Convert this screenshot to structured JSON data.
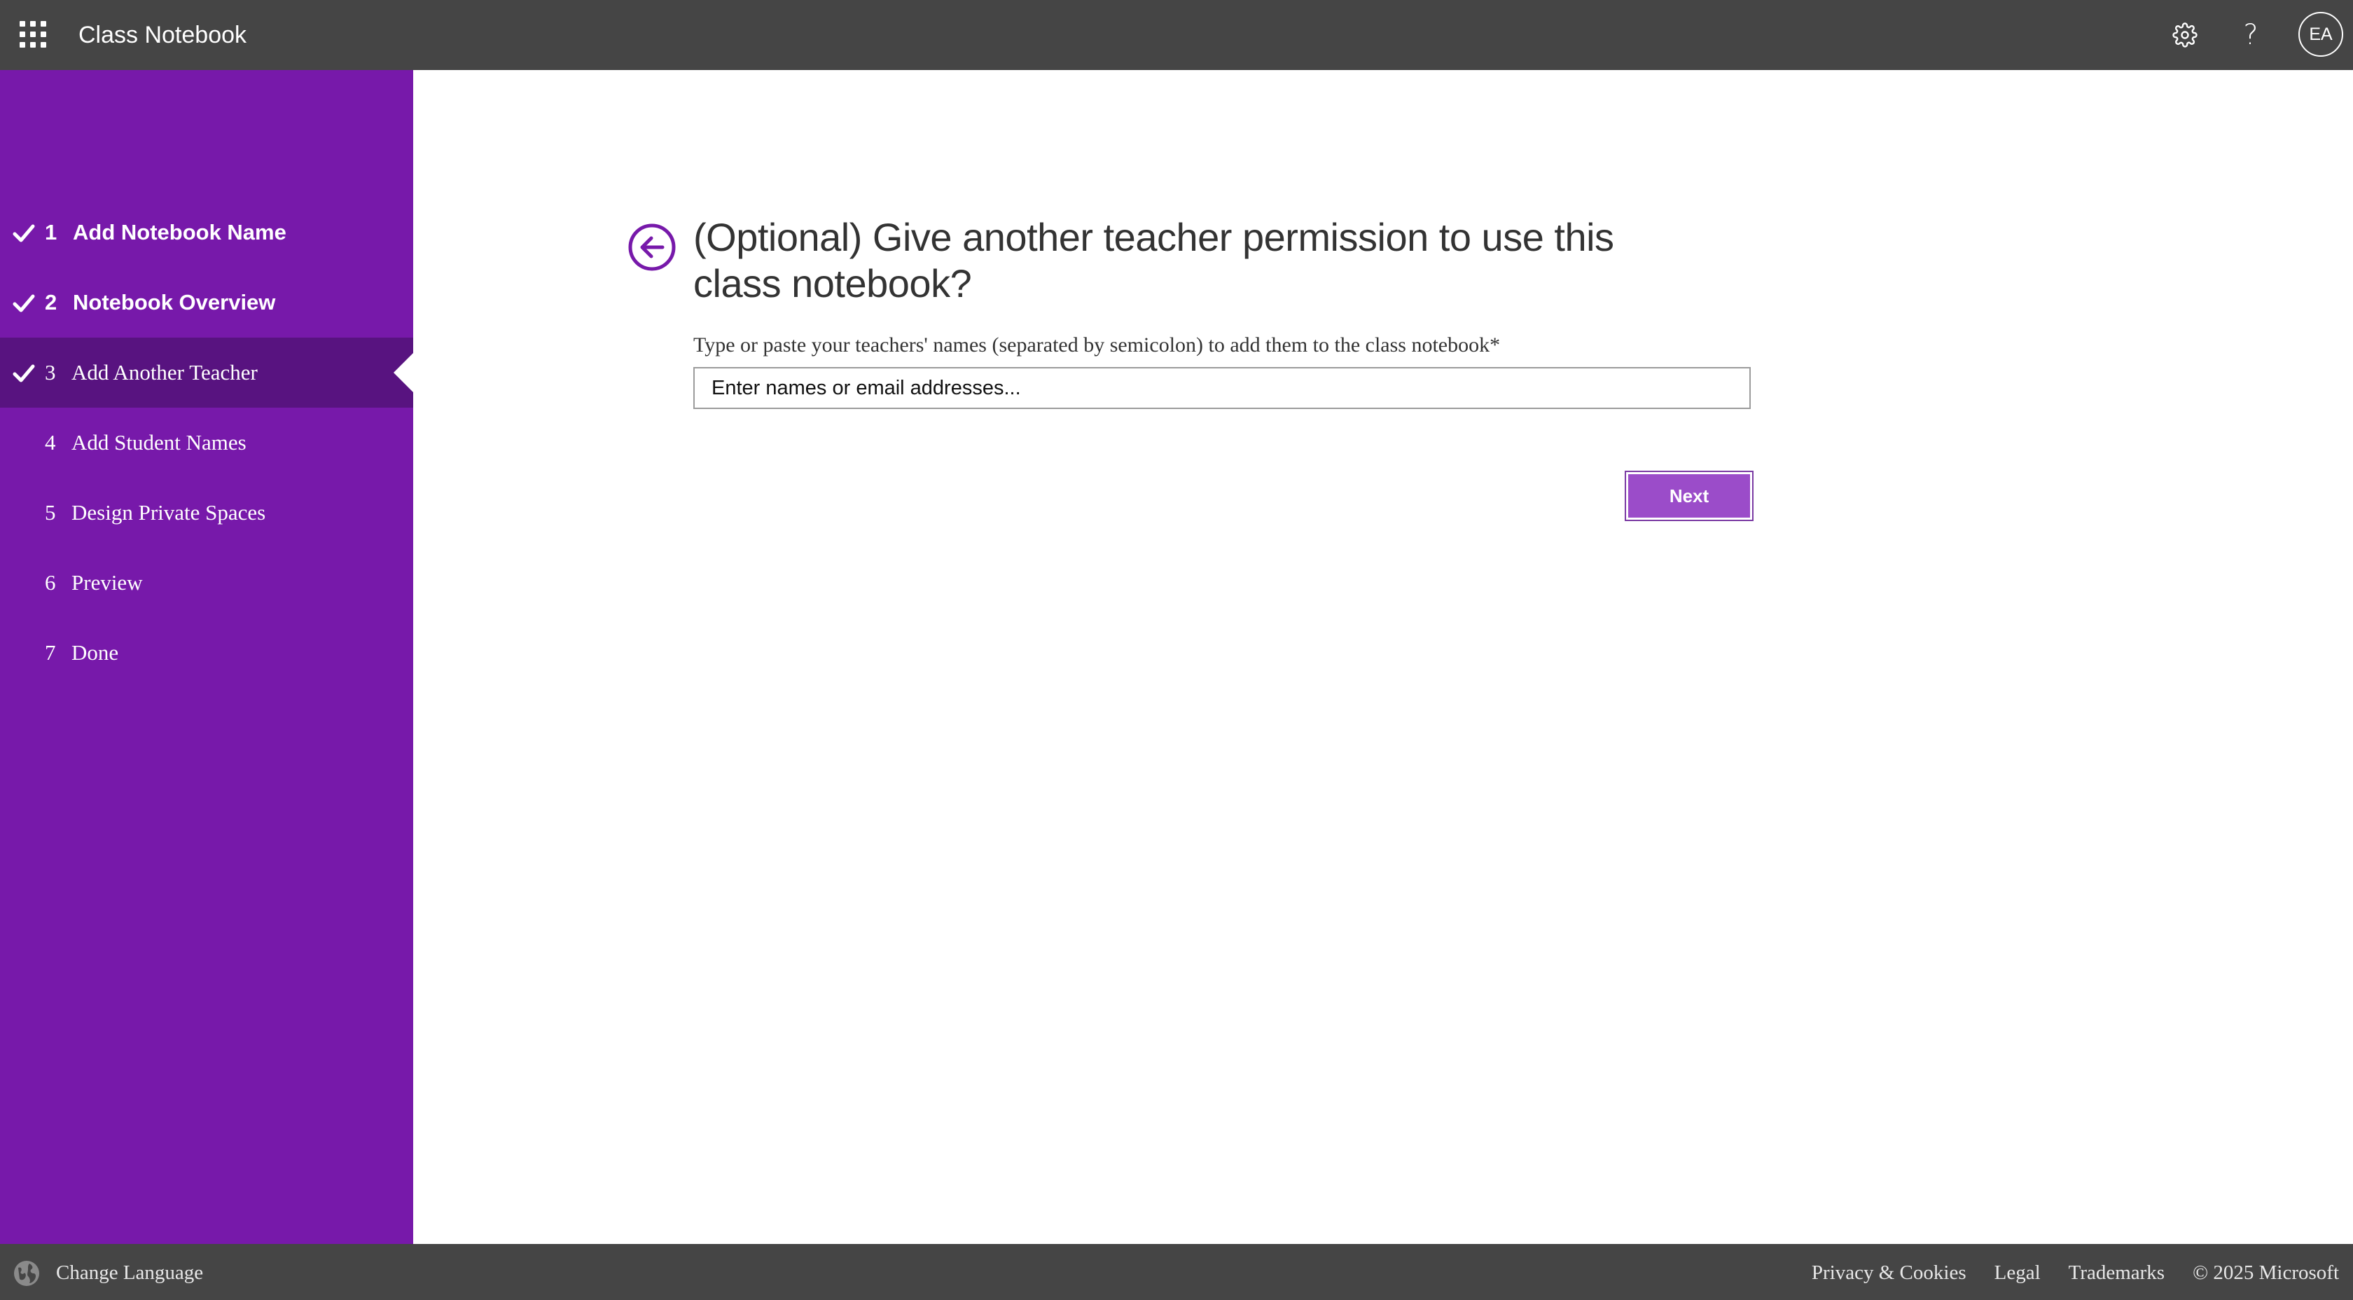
{
  "header": {
    "app_title": "Class Notebook",
    "launcher_icon": "app-launcher-waffle-icon",
    "settings_icon": "gear-icon",
    "help_label": "?",
    "avatar_initials": "EA",
    "background_color": "#454545"
  },
  "sidebar": {
    "background_color": "#7719aa",
    "active_color": "#581380",
    "steps": [
      {
        "number": "1",
        "label": "Add Notebook Name",
        "completed": true,
        "active": false
      },
      {
        "number": "2",
        "label": "Notebook Overview",
        "completed": true,
        "active": false
      },
      {
        "number": "3",
        "label": "Add Another Teacher",
        "completed": true,
        "active": true
      },
      {
        "number": "4",
        "label": "Add Student Names",
        "completed": false,
        "active": false
      },
      {
        "number": "5",
        "label": "Design Private Spaces",
        "completed": false,
        "active": false
      },
      {
        "number": "6",
        "label": "Preview",
        "completed": false,
        "active": false
      },
      {
        "number": "7",
        "label": "Done",
        "completed": false,
        "active": false
      }
    ]
  },
  "main": {
    "back_icon": "arrow-left-circle-icon",
    "title": "(Optional) Give another teacher permission to use this class notebook?",
    "field_label": "Type or paste your teachers' names (separated by semicolon) to add them to the class notebook*",
    "input_value": "",
    "input_placeholder": "Enter names or email addresses...",
    "next_label": "Next",
    "accent_color": "#7719aa"
  },
  "footer": {
    "globe_icon": "globe-icon",
    "change_language": "Change Language",
    "links": [
      "Privacy & Cookies",
      "Legal",
      "Trademarks"
    ],
    "copyright": "© 2025 Microsoft"
  }
}
